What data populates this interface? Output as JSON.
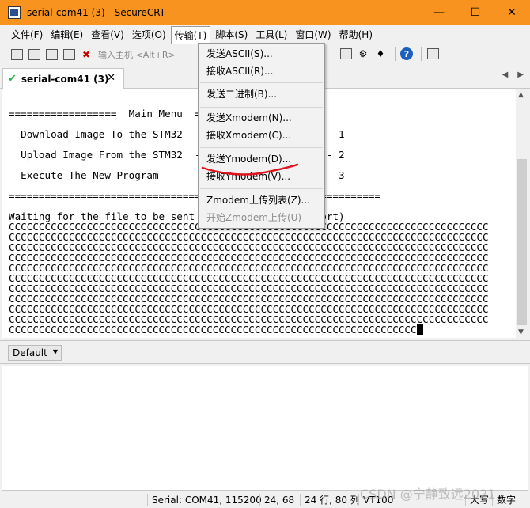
{
  "window": {
    "title": "serial-com41 (3) - SecureCRT",
    "minimize": "—",
    "maximize": "☐",
    "close": "✕"
  },
  "menubar": [
    {
      "label": "文件(F)"
    },
    {
      "label": "编辑(E)"
    },
    {
      "label": "查看(V)"
    },
    {
      "label": "选项(O)"
    },
    {
      "label": "传输(T)",
      "active": true
    },
    {
      "label": "脚本(S)"
    },
    {
      "label": "工具(L)"
    },
    {
      "label": "窗口(W)"
    },
    {
      "label": "帮助(H)"
    }
  ],
  "toolbar": {
    "quick_connect_placeholder": "输入主机 <Alt+R>",
    "help": "?"
  },
  "tab": {
    "label": "serial-com41 (3)",
    "close": "✕",
    "prev": "◀",
    "next": "▶"
  },
  "terminal": {
    "lines": [
      "==================  Main Menu  ==================",
      "  Download Image To the STM32  ----------------------- 1",
      "  Upload Image From the STM32  ----------------------- 2",
      "  Execute The New Program  --------------------------- 3",
      "==============================================================",
      "Waiting for the file to be sent ... (press 'a' to abort)",
      "CCCCCCCCCCCCCCCCCCCCCCCCCCCCCCCCCCCCCCCCCCCCCCCCCCCCCCCCCCCCCCCCCCCCCCCCCCCCCCCC",
      "CCCCCCCCCCCCCCCCCCCCCCCCCCCCCCCCCCCCCCCCCCCCCCCCCCCCCCCCCCCCCCCCCCCCCCCCCCCCCCCC",
      "CCCCCCCCCCCCCCCCCCCCCCCCCCCCCCCCCCCCCCCCCCCCCCCCCCCCCCCCCCCCCCCCCCCCCCCCCCCCCCCC",
      "CCCCCCCCCCCCCCCCCCCCCCCCCCCCCCCCCCCCCCCCCCCCCCCCCCCCCCCCCCCCCCCCCCCCCCCCCCCCCCCC",
      "CCCCCCCCCCCCCCCCCCCCCCCCCCCCCCCCCCCCCCCCCCCCCCCCCCCCCCCCCCCCCCCCCCCCCCCCCCCCCCCC",
      "CCCCCCCCCCCCCCCCCCCCCCCCCCCCCCCCCCCCCCCCCCCCCCCCCCCCCCCCCCCCCCCCCCCCCCCCCCCCCCCC",
      "CCCCCCCCCCCCCCCCCCCCCCCCCCCCCCCCCCCCCCCCCCCCCCCCCCCCCCCCCCCCCCCCCCCCCCCCCCCCCCCC",
      "CCCCCCCCCCCCCCCCCCCCCCCCCCCCCCCCCCCCCCCCCCCCCCCCCCCCCCCCCCCCCCCCCCCCCCCCCCCCCCCC",
      "CCCCCCCCCCCCCCCCCCCCCCCCCCCCCCCCCCCCCCCCCCCCCCCCCCCCCCCCCCCCCCCCCCCCCCCCCCCCCCCC",
      "CCCCCCCCCCCCCCCCCCCCCCCCCCCCCCCCCCCCCCCCCCCCCCCCCCCCCCCCCCCCCCCCCCCCCCCCCCCCCCCC",
      "CCCCCCCCCCCCCCCCCCCCCCCCCCCCCCCCCCCCCCCCCCCCCCCCCCCCCCCCCCCCCCCCCCCCCCCCCCCCCCCC",
      "CCCCCCCCCCCCCCCCCCCCCCCCCCCCCCCCCCCCCCCCCCCCCCCCCCCCCCCCCCCCCCCCCCCCCCCCCCCCCCCC",
      "CCCCCCCCCCCCCCCCCCCCCCCCCCCCCCCCCCCCCCCCCCCCCCCCCCCCCCCCCCCCCCCCCCCCCCCCCCCCCCCC",
      "CCCCCCCCCCCCCCCCCCCCCCCCCCCCCCCCCCCCCCCCCCCCCCCCCCCCCCCCCCCCCCCCCCCC"
    ]
  },
  "transfer_menu": [
    {
      "label": "发送ASCII(S)...",
      "enabled": true
    },
    {
      "label": "接收ASCII(R)...",
      "enabled": true
    },
    {
      "label": "发送二进制(B)...",
      "enabled": true
    },
    {
      "label": "发送Xmodem(N)...",
      "enabled": true
    },
    {
      "label": "接收Xmodem(C)...",
      "enabled": true
    },
    {
      "label": "发送Ymodem(D)...",
      "enabled": true
    },
    {
      "label": "接收Ymodem(V)...",
      "enabled": true
    },
    {
      "label": "Zmodem上传列表(Z)...",
      "enabled": true
    },
    {
      "label": "开始Zmodem上传(U)",
      "enabled": false
    }
  ],
  "command_bar": {
    "session_select": "Default"
  },
  "statusbar": {
    "connection": "Serial: COM41, 115200",
    "cursor_pos": "24,  68",
    "size": "24 行, 80 列",
    "emulation": "VT100",
    "caps": "大写",
    "num": "数字"
  },
  "watermark": "CSDN @宁静致远2021",
  "colors": {
    "titlebar": "#f7931e",
    "annotation_stroke": "#e0141e",
    "tab_check": "#2bb24c"
  }
}
